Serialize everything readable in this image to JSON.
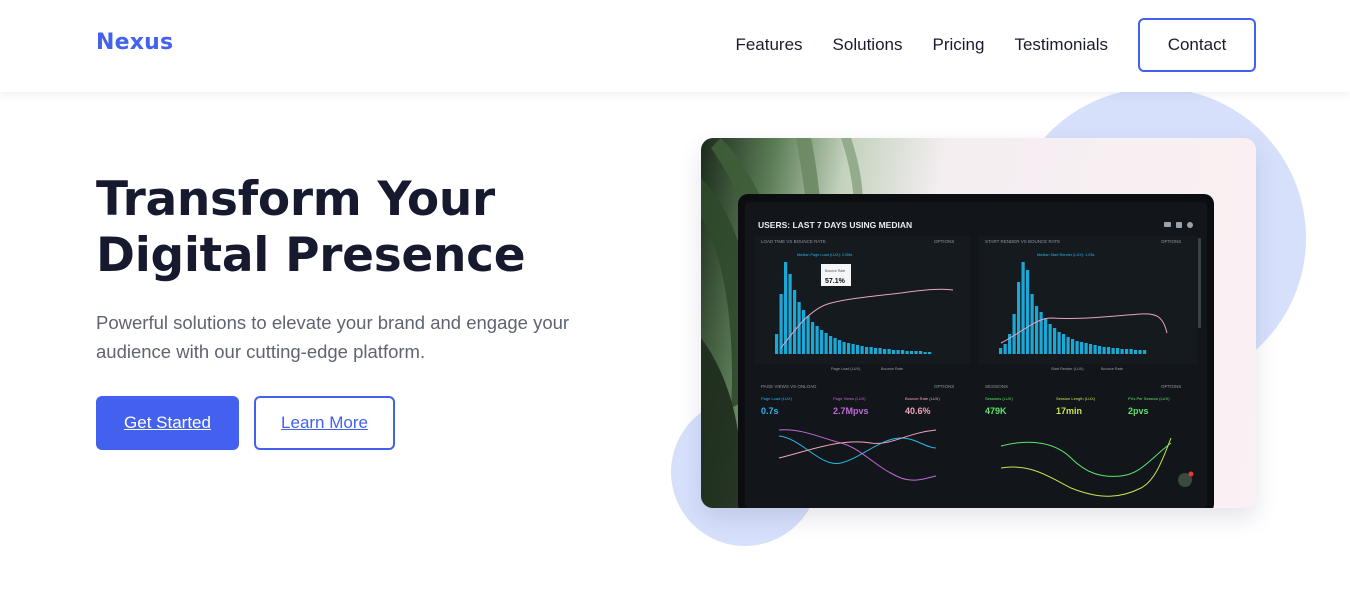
{
  "brand": {
    "name": "Nexus",
    "accent": "#4361ee",
    "circle_color": "#d7e0fb"
  },
  "nav": {
    "items": [
      {
        "label": "Features"
      },
      {
        "label": "Solutions"
      },
      {
        "label": "Pricing"
      },
      {
        "label": "Testimonials"
      }
    ],
    "contact_label": "Contact"
  },
  "hero": {
    "title_line1": "Transform Your",
    "title_line2": "Digital Presence",
    "subtitle": "Powerful solutions to elevate your brand and engage your audience with our cutting-edge platform.",
    "primary_cta": "Get Started",
    "secondary_cta": "Learn More"
  },
  "dashboard_screen": {
    "header": "USERS: LAST 7 DAYS USING MEDIAN",
    "panels": {
      "load_time": {
        "title": "LOAD TIME VS BOUNCE RATE",
        "options": "OPTIONS",
        "tooltip_label": "Bounce Rate",
        "tooltip_value": "57.1%",
        "median_label": "Median Page Load (LUX): 2.0Ms",
        "legend_a": "Page Load (LUX)",
        "legend_b": "Bounce Rate"
      },
      "start_render": {
        "title": "START RENDER VS BOUNCE RATE",
        "options": "OPTIONS",
        "median_label": "Median Start Render (LUX): 1.03s",
        "legend_a": "Start Render (LUX)",
        "legend_b": "Bounce Rate"
      },
      "page_views": {
        "title": "PAGE VIEWS VS ONLOAD",
        "options": "OPTIONS",
        "metrics": [
          {
            "label": "Page Load (LUX)",
            "value": "0.7s"
          },
          {
            "label": "Page Views (LUX)",
            "value": "2.7Mpvs"
          },
          {
            "label": "Bounce Rate (LUX)",
            "value": "40.6%"
          }
        ]
      },
      "sessions": {
        "title": "SESSIONS",
        "options": "OPTIONS",
        "metrics": [
          {
            "label": "Sessions (LUX)",
            "value": "479K"
          },
          {
            "label": "Session Length (LUX)",
            "value": "17min"
          },
          {
            "label": "PVs Per Session (LUX)",
            "value": "2pvs"
          }
        ]
      }
    }
  }
}
